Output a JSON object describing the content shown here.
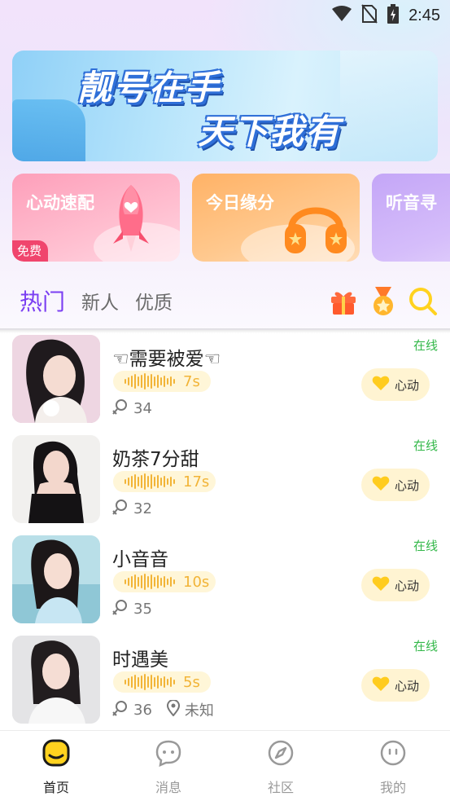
{
  "status_bar": {
    "time": "2:45",
    "icons": [
      "wifi-icon",
      "no-sim-icon",
      "battery-charging-icon"
    ]
  },
  "banner": {
    "line1": "靓号在手",
    "line2": "天下我有"
  },
  "features": [
    {
      "title": "心动速配",
      "badge": "免费",
      "icon": "rocket-icon"
    },
    {
      "title": "今日缘分",
      "icon": "headphones-icon"
    },
    {
      "title": "听音寻"
    }
  ],
  "tabs": [
    {
      "label": "热门",
      "active": true
    },
    {
      "label": "新人",
      "active": false
    },
    {
      "label": "优质",
      "active": false
    }
  ],
  "toolbar_icons": [
    "gift-icon",
    "medal-icon",
    "search-icon"
  ],
  "users": [
    {
      "name": "☜需要被爱☜",
      "duration": "7s",
      "fans": "34",
      "location": "",
      "status": "在线",
      "action": "心动"
    },
    {
      "name": "奶茶7分甜",
      "duration": "17s",
      "fans": "32",
      "location": "",
      "status": "在线",
      "action": "心动"
    },
    {
      "name": "小音音",
      "duration": "10s",
      "fans": "35",
      "location": "",
      "status": "在线",
      "action": "心动"
    },
    {
      "name": "时遇美",
      "duration": "5s",
      "fans": "36",
      "location": "未知",
      "status": "在线",
      "action": "心动"
    }
  ],
  "bottom_nav": [
    {
      "label": "首页",
      "active": true,
      "icon": "home-face-icon"
    },
    {
      "label": "消息",
      "active": false,
      "icon": "message-icon"
    },
    {
      "label": "社区",
      "active": false,
      "icon": "compass-icon"
    },
    {
      "label": "我的",
      "active": false,
      "icon": "profile-face-icon"
    }
  ],
  "colors": {
    "accent": "#7b3ff2",
    "online": "#34b84a",
    "voice": "#f2b437",
    "badge": "#f0456d"
  }
}
